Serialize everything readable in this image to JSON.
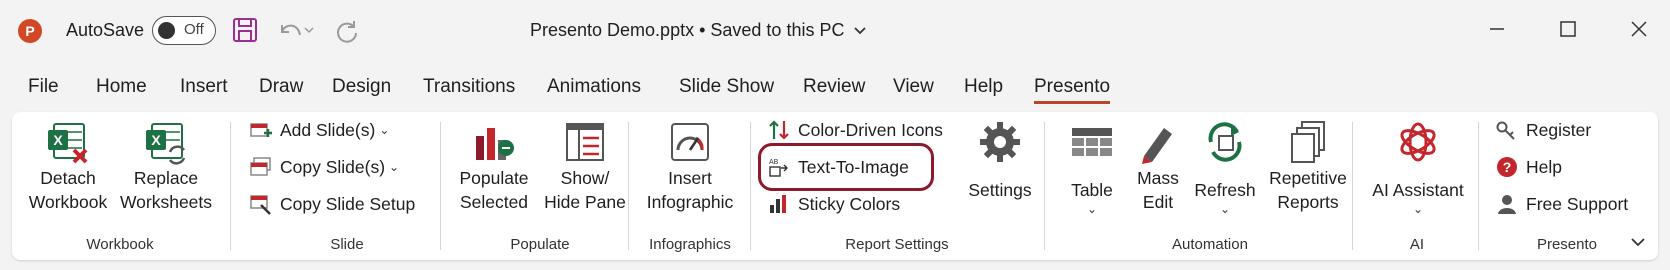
{
  "titlebar": {
    "autosave_label": "AutoSave",
    "toggle_state": "Off",
    "doc_title": "Presento Demo.pptx • Saved to this PC",
    "app_letter": "P"
  },
  "tabs": [
    "File",
    "Home",
    "Insert",
    "Draw",
    "Design",
    "Transitions",
    "Animations",
    "Slide Show",
    "Review",
    "View",
    "Help",
    "Presento"
  ],
  "active_tab": "Presento",
  "groups": {
    "workbook": {
      "label": "Workbook",
      "detach": [
        "Detach",
        "Workbook"
      ],
      "replace": [
        "Replace",
        "Worksheets"
      ]
    },
    "slide": {
      "label": "Slide",
      "add": "Add Slide(s)",
      "copy": "Copy Slide(s)",
      "setup": "Copy Slide Setup"
    },
    "populate": {
      "label": "Populate",
      "selected": [
        "Populate",
        "Selected"
      ],
      "pane": [
        "Show/",
        "Hide Pane"
      ]
    },
    "infographics": {
      "label": "Infographics",
      "insert": [
        "Insert",
        "Infographic"
      ]
    },
    "report": {
      "label": "Report Settings",
      "color_icons": "Color-Driven Icons",
      "text_to_image": "Text-To-Image",
      "sticky": "Sticky Colors",
      "settings": "Settings"
    },
    "automation": {
      "label": "Automation",
      "table": "Table",
      "mass": [
        "Mass",
        "Edit"
      ],
      "refresh": "Refresh",
      "repetitive": [
        "Repetitive",
        "Reports"
      ]
    },
    "ai": {
      "label": "AI",
      "assistant": "AI Assistant"
    },
    "presento": {
      "label": "Presento",
      "register": "Register",
      "help": "Help",
      "support": "Free Support"
    }
  },
  "colors": {
    "accent": "#b7472a",
    "highlight": "#8b1a2b",
    "excel_green": "#1e7145",
    "danger_red": "#c4262e",
    "ribbon_bg": "#ffffff",
    "titlebar_bg": "#f3f3f3"
  }
}
